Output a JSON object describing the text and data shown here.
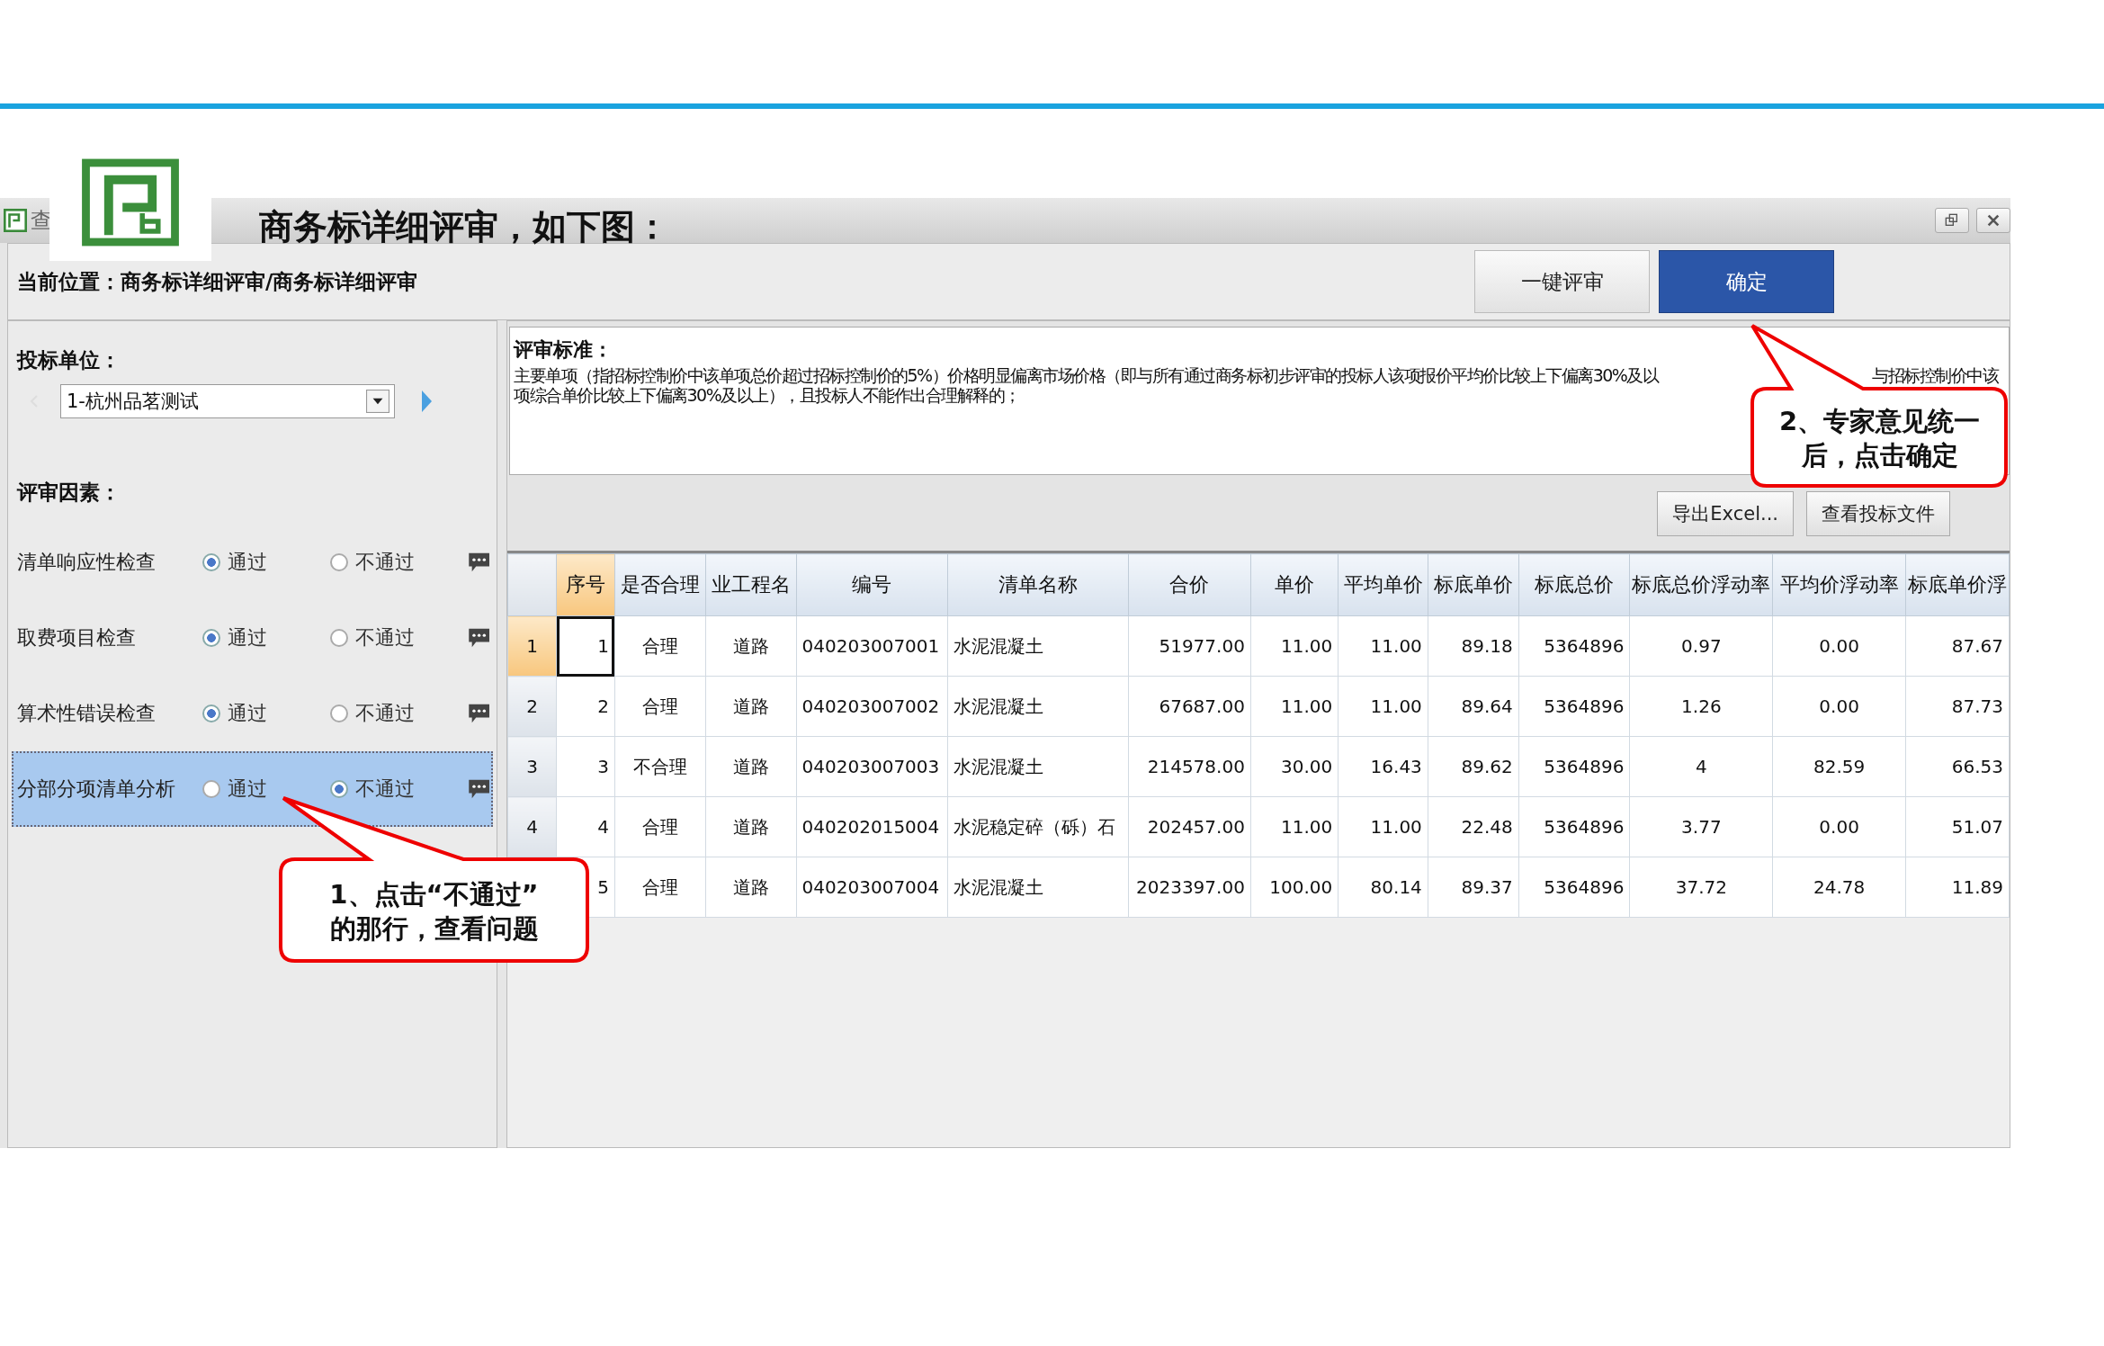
{
  "slide": {
    "heading": "商务标详细评审，如下图："
  },
  "window": {
    "title_fragment": "查",
    "breadcrumb": "当前位置：商务标详细评审/商务标详细评审",
    "buttons": [
      {
        "label": "一键评审",
        "primary": false
      },
      {
        "label": "确定",
        "primary": true
      }
    ]
  },
  "left_panel": {
    "bidder_label": "投标单位：",
    "bidder_value": "1-杭州品茗测试",
    "factors_label": "评审因素：",
    "factors": [
      {
        "name": "清单响应性检查",
        "selected": false,
        "options": [
          {
            "label": "通过",
            "selected": true
          },
          {
            "label": "不通过",
            "selected": false
          }
        ]
      },
      {
        "name": "取费项目检查",
        "selected": false,
        "options": [
          {
            "label": "通过",
            "selected": true
          },
          {
            "label": "不通过",
            "selected": false
          }
        ]
      },
      {
        "name": "算术性错误检查",
        "selected": false,
        "options": [
          {
            "label": "通过",
            "selected": true
          },
          {
            "label": "不通过",
            "selected": false
          }
        ]
      },
      {
        "name": "分部分项清单分析",
        "selected": true,
        "options": [
          {
            "label": "通过",
            "selected": false
          },
          {
            "label": "不通过",
            "selected": true
          }
        ]
      }
    ]
  },
  "criteria": {
    "label": "评审标准：",
    "line_1": "主要单项（指招标控制价中该单项总价超过招标控制价的5%）价格明显偏离市场价格（即与所有通过商务标初步评审的投标人该项报价平均价比较上下偏离30%及以",
    "line_1_tail": "与招标控制价中该",
    "line_2": "项综合单价比较上下偏离30%及以上），且投标人不能作出合理解释的；"
  },
  "toolbar": {
    "buttons": [
      "导出Excel...",
      "查看投标文件"
    ]
  },
  "table": {
    "columns": [
      {
        "label": "序号",
        "selected": true
      },
      {
        "label": "是否合理",
        "selected": false
      },
      {
        "label": "业工程名",
        "selected": false
      },
      {
        "label": "编号",
        "selected": false
      },
      {
        "label": "清单名称",
        "selected": false
      },
      {
        "label": "合价",
        "selected": false
      },
      {
        "label": "单价",
        "selected": false
      },
      {
        "label": "平均单价",
        "selected": false
      },
      {
        "label": "标底单价",
        "selected": false
      },
      {
        "label": "标底总价",
        "selected": false
      },
      {
        "label": "标底总价浮动率",
        "selected": false
      },
      {
        "label": "平均价浮动率",
        "selected": false
      },
      {
        "label": "标底单价浮",
        "selected": false
      }
    ],
    "rows": [
      {
        "header": "1",
        "selected": true,
        "cells": [
          "1",
          "合理",
          "道路",
          "040203007001",
          "水泥混凝土",
          "51977.00",
          "11.00",
          "11.00",
          "89.18",
          "5364896",
          "0.97",
          "0.00",
          "87.67"
        ]
      },
      {
        "header": "2",
        "selected": false,
        "cells": [
          "2",
          "合理",
          "道路",
          "040203007002",
          "水泥混凝土",
          "67687.00",
          "11.00",
          "11.00",
          "89.64",
          "5364896",
          "1.26",
          "0.00",
          "87.73"
        ]
      },
      {
        "header": "3",
        "selected": false,
        "cells": [
          "3",
          "不合理",
          "道路",
          "040203007003",
          "水泥混凝土",
          "214578.00",
          "30.00",
          "16.43",
          "89.62",
          "5364896",
          "4",
          "82.59",
          "66.53"
        ]
      },
      {
        "header": "4",
        "selected": false,
        "cells": [
          "4",
          "合理",
          "道路",
          "040202015004",
          "水泥稳定碎（砾）石",
          "202457.00",
          "11.00",
          "11.00",
          "22.48",
          "5364896",
          "3.77",
          "0.00",
          "51.07"
        ]
      },
      {
        "selected": false,
        "cells": [
          "5",
          "合理",
          "道路",
          "040203007004",
          "水泥混凝土",
          "2023397.00",
          "100.00",
          "80.14",
          "89.37",
          "5364896",
          "37.72",
          "24.78",
          "11.89"
        ]
      }
    ]
  },
  "callouts": [
    {
      "lines": [
        "1、点击“不通过”",
        "的那行，查看问题"
      ]
    },
    {
      "lines": [
        "2、专家意见统一",
        "后，点击确定"
      ]
    }
  ]
}
